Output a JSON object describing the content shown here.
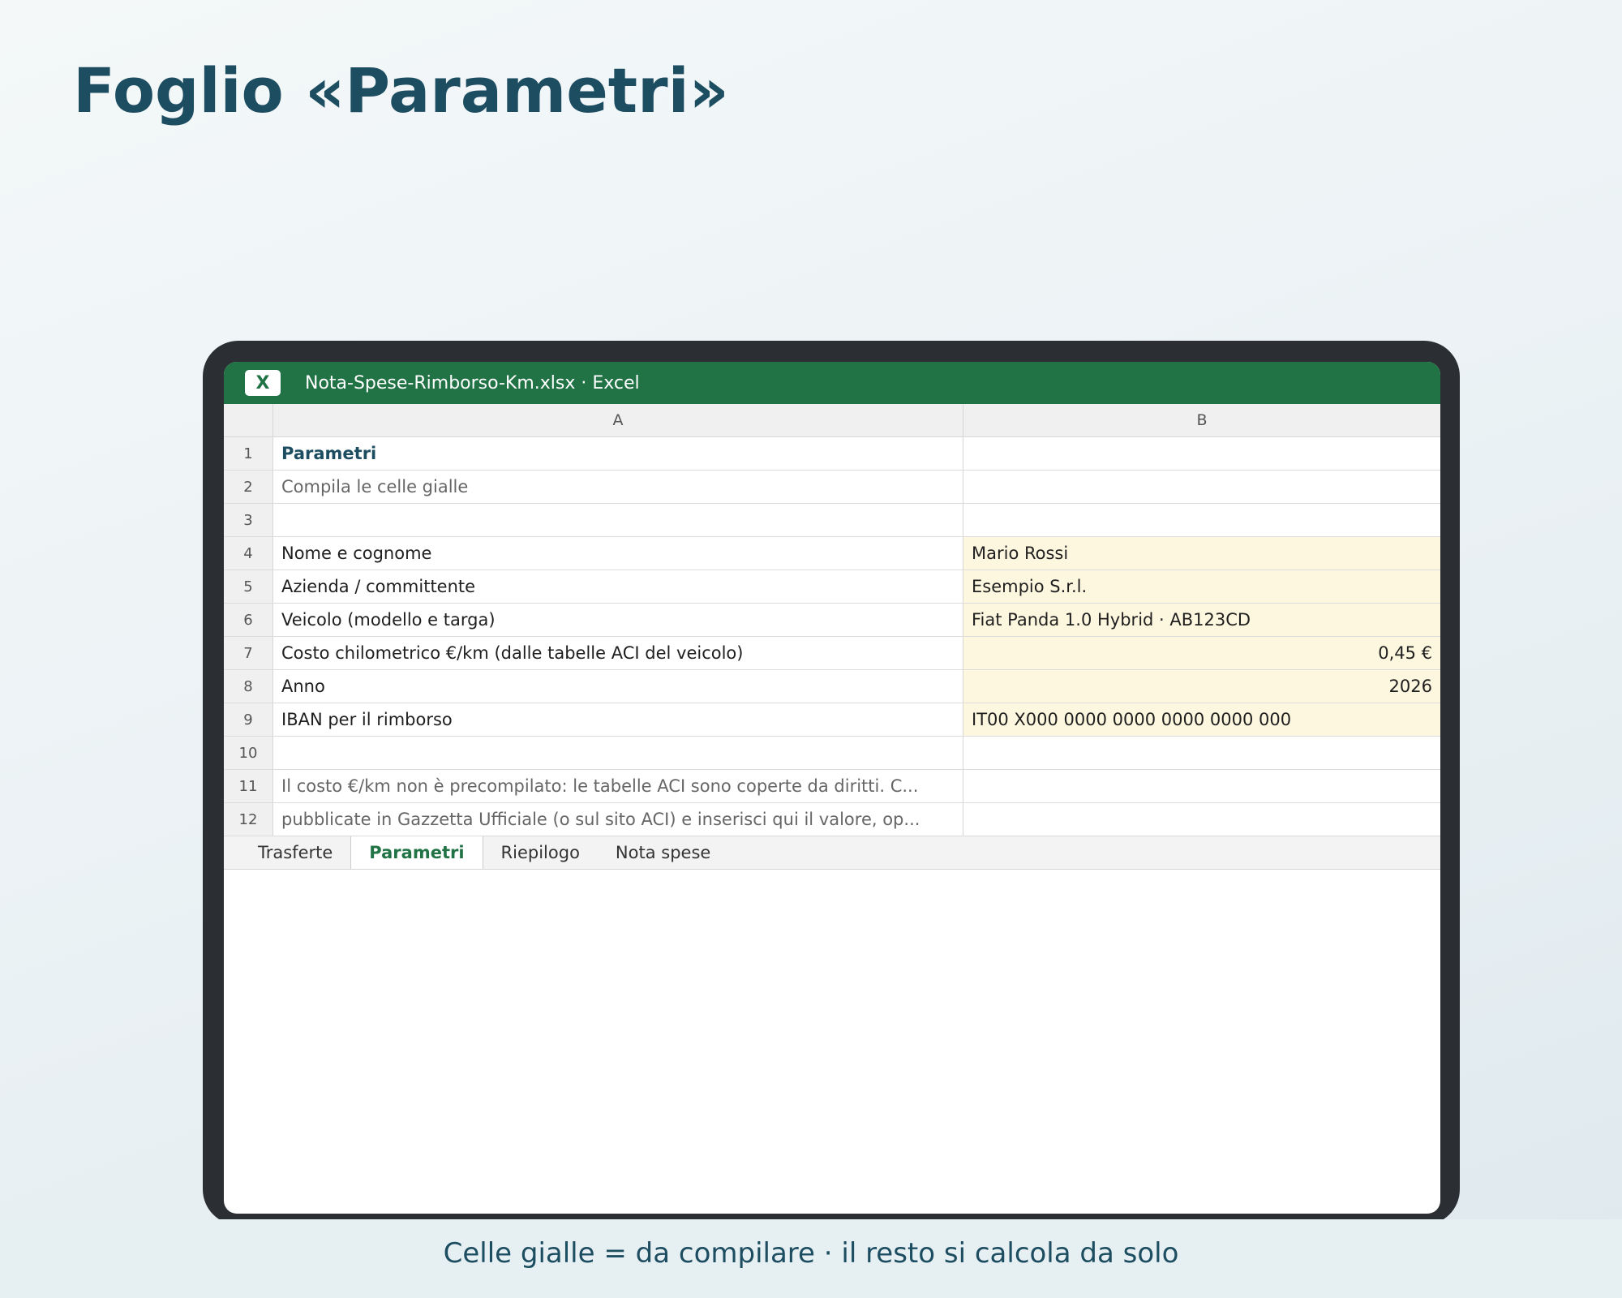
{
  "page": {
    "title": "Foglio «Parametri»",
    "footer": "Celle gialle = da compilare · il resto si calcola da solo"
  },
  "window": {
    "app_icon_letter": "X",
    "title": "Nota-Spese-Rimborso-Km.xlsx · Excel"
  },
  "sheet": {
    "columns": [
      "A",
      "B"
    ],
    "rows": [
      {
        "num": "1",
        "a": "Parametri",
        "b": ""
      },
      {
        "num": "2",
        "a": "Compila le celle gialle",
        "b": ""
      },
      {
        "num": "3",
        "a": "",
        "b": ""
      },
      {
        "num": "4",
        "a": "Nome e cognome",
        "b": "Mario Rossi"
      },
      {
        "num": "5",
        "a": "Azienda / committente",
        "b": "Esempio S.r.l."
      },
      {
        "num": "6",
        "a": "Veicolo (modello e targa)",
        "b": "Fiat Panda 1.0 Hybrid · AB123CD"
      },
      {
        "num": "7",
        "a": "Costo chilometrico €/km (dalle tabelle ACI del veicolo)",
        "b": "0,45 €"
      },
      {
        "num": "8",
        "a": "Anno",
        "b": "2026"
      },
      {
        "num": "9",
        "a": "IBAN per il rimborso",
        "b": "IT00 X000 0000 0000 0000 0000 000"
      },
      {
        "num": "10",
        "a": "",
        "b": ""
      },
      {
        "num": "11",
        "a": "Il costo €/km non è precompilato: le tabelle ACI sono coperte da diritti. C...",
        "b": ""
      },
      {
        "num": "12",
        "a": "pubblicate in Gazzetta Ufficiale (o sul sito ACI) e inserisci qui il valore, op...",
        "b": ""
      }
    ],
    "tabs": [
      {
        "label": "Trasferte"
      },
      {
        "label": "Parametri"
      },
      {
        "label": "Riepilogo"
      },
      {
        "label": "Nota spese"
      }
    ]
  },
  "colors": {
    "excel_green": "#217346",
    "input_yellow": "#fef7df",
    "title_blue": "#1d4d61"
  }
}
